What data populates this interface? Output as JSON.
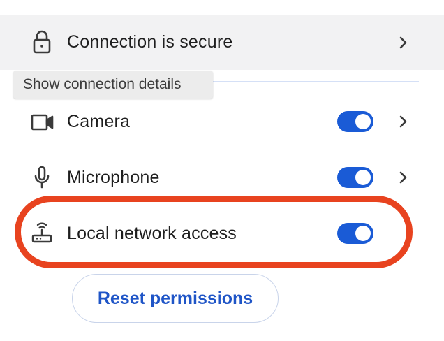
{
  "connection": {
    "label": "Connection is secure",
    "icon": "lock-icon"
  },
  "tooltip": {
    "text": "Show connection details"
  },
  "permissions": [
    {
      "label": "Camera",
      "icon": "camera-icon",
      "enabled": true,
      "has_details": true
    },
    {
      "label": "Microphone",
      "icon": "microphone-icon",
      "enabled": true,
      "has_details": true
    },
    {
      "label": "Local network access",
      "icon": "router-icon",
      "enabled": true,
      "has_details": false
    }
  ],
  "reset_button": {
    "label": "Reset permissions"
  },
  "colors": {
    "toggle_on": "#1a5bd6",
    "highlight_ring": "#e8431f",
    "button_text": "#1f55c7",
    "connection_row_bg": "#f2f2f3"
  }
}
